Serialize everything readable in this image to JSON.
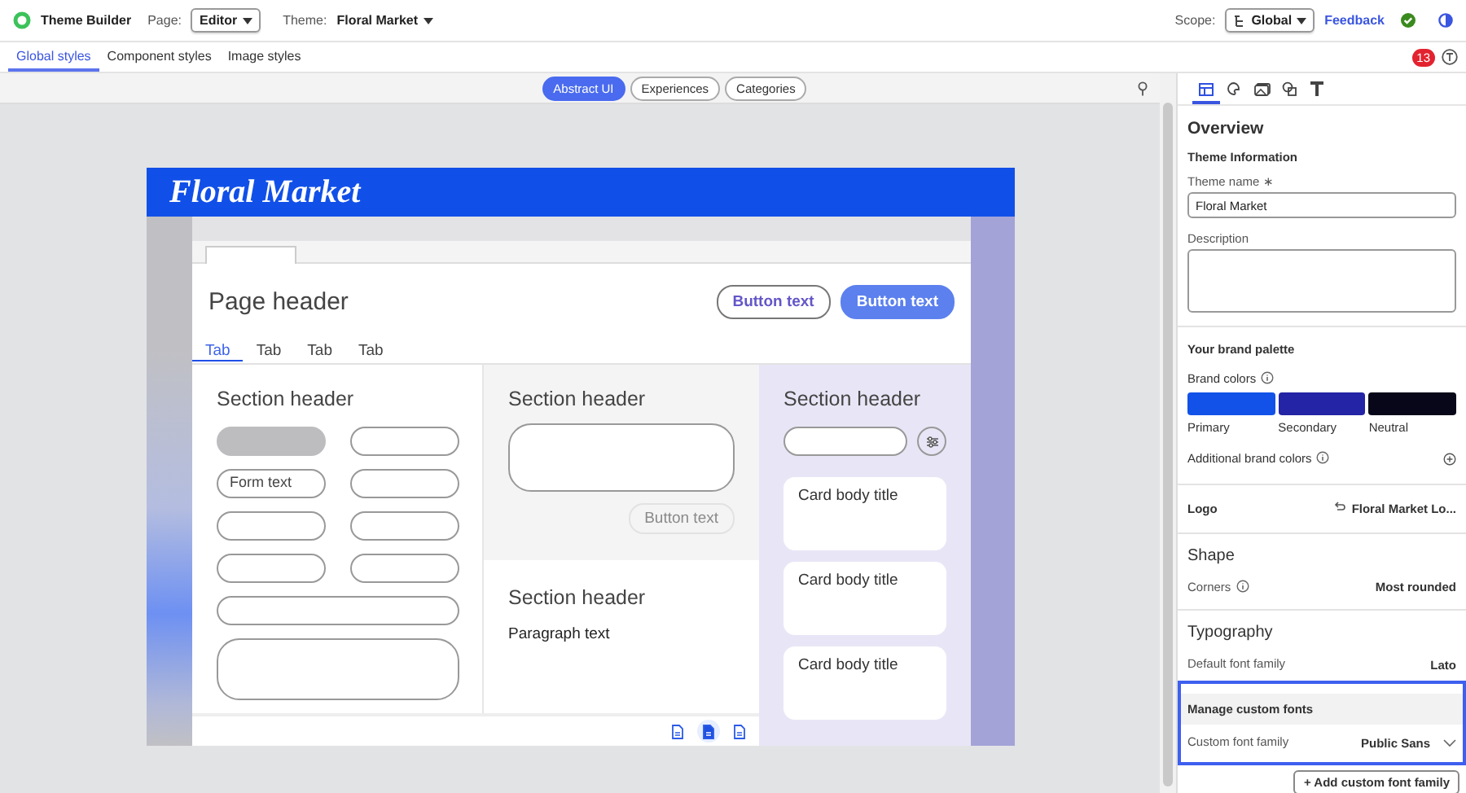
{
  "app": {
    "name": "Theme Builder",
    "page_label": "Page:",
    "page_value": "Editor",
    "theme_label": "Theme:",
    "theme_value": "Floral Market",
    "scope_label": "Scope:",
    "scope_value": "Global",
    "feedback": "Feedback"
  },
  "tabs": [
    {
      "label": "Global styles",
      "selected": true
    },
    {
      "label": "Component styles",
      "selected": false
    },
    {
      "label": "Image styles",
      "selected": false
    }
  ],
  "notification_count": "13",
  "view_options": [
    {
      "label": "Abstract UI",
      "selected": true
    },
    {
      "label": "Experiences",
      "selected": false
    },
    {
      "label": "Categories",
      "selected": false
    }
  ],
  "preview": {
    "logo": "Floral Market",
    "page_header": "Page header",
    "buttons": [
      {
        "label": "Button text",
        "kind": "outline"
      },
      {
        "label": "Button text",
        "kind": "filled"
      }
    ],
    "tabs": [
      {
        "label": "Tab",
        "selected": true
      },
      {
        "label": "Tab",
        "selected": false
      },
      {
        "label": "Tab",
        "selected": false
      },
      {
        "label": "Tab",
        "selected": false
      }
    ],
    "form_section": {
      "header": "Section header",
      "fields": [
        {
          "kind": "half",
          "disabled": true
        },
        {
          "kind": "half",
          "disabled": false
        },
        {
          "kind": "half",
          "disabled": false,
          "value": "Form text"
        },
        {
          "kind": "half",
          "disabled": false
        },
        {
          "kind": "half",
          "disabled": false
        },
        {
          "kind": "half",
          "disabled": false
        },
        {
          "kind": "half",
          "disabled": false
        },
        {
          "kind": "half",
          "disabled": false
        },
        {
          "kind": "full",
          "disabled": false
        },
        {
          "kind": "textarea",
          "disabled": false
        }
      ]
    },
    "input_section": {
      "header": "Section header",
      "button": {
        "label": "Button text",
        "disabled": true
      }
    },
    "text_section": {
      "header": "Section header",
      "paragraph": "Paragraph text"
    },
    "card_section": {
      "header": "Section header",
      "cards": [
        "Card body title",
        "Card body title",
        "Card body title"
      ]
    },
    "devices": [
      {
        "selected": false
      },
      {
        "selected": true
      },
      {
        "selected": false
      }
    ]
  },
  "panel": {
    "tabs": [
      {
        "selected": true
      },
      {
        "selected": false
      },
      {
        "selected": false
      },
      {
        "selected": false
      },
      {
        "selected": false
      }
    ],
    "title": "Overview",
    "info_heading": "Theme Information",
    "name_label": "Theme name",
    "required_mark": "∗",
    "name_value": "Floral Market",
    "description_label": "Description",
    "palette_heading": "Your brand palette",
    "brand_colors_label": "Brand colors",
    "swatches": [
      {
        "label": "Primary",
        "color": "#1252e8"
      },
      {
        "label": "Secondary",
        "color": "#2424a6"
      },
      {
        "label": "Neutral",
        "color": "#070719"
      }
    ],
    "additional_label": "Additional brand colors",
    "logo_label": "Logo",
    "logo_value": "Floral Market Lo...",
    "shape_heading": "Shape",
    "corners_label": "Corners",
    "corners_value": "Most rounded",
    "typography_heading": "Typography",
    "default_font_label": "Default font family",
    "default_font_value": "Lato",
    "custom_fonts": {
      "highlighted": true,
      "heading": "Manage custom fonts",
      "label": "Custom font family",
      "value": "Public Sans"
    },
    "add_button": "+ Add custom font family"
  }
}
